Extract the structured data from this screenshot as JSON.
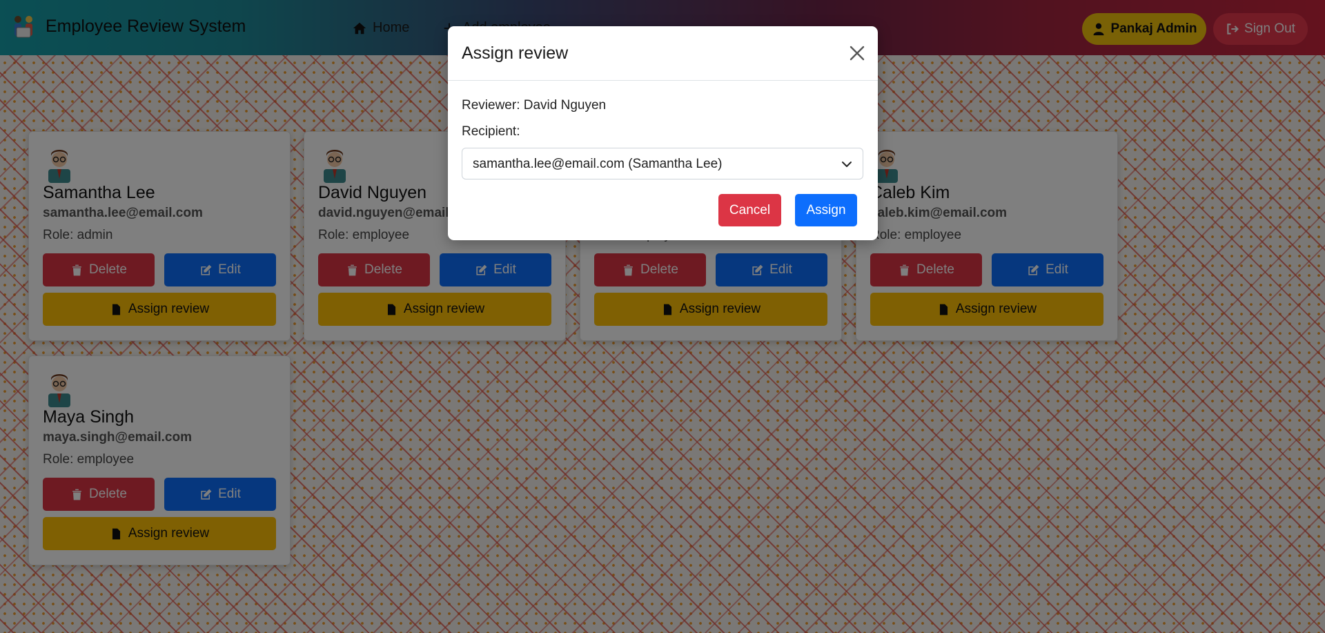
{
  "app": {
    "title": "Employee Review System"
  },
  "nav": {
    "home_label": "Home",
    "add_label": "Add employee"
  },
  "user": {
    "name": "Pankaj Admin",
    "signout_label": "Sign Out"
  },
  "card_actions": {
    "delete_label": "Delete",
    "edit_label": "Edit",
    "assign_label": "Assign review"
  },
  "employees": [
    {
      "name": "Samantha Lee",
      "email": "samantha.lee@email.com",
      "role": "Role: admin"
    },
    {
      "name": "David Nguyen",
      "email": "david.nguyen@email.com",
      "role": "Role: employee"
    },
    {
      "name": "",
      "email": "",
      "role": "Role: employee"
    },
    {
      "name": "Caleb Kim",
      "email": "caleb.kim@email.com",
      "role": "Role: employee"
    },
    {
      "name": "Maya Singh",
      "email": "maya.singh@email.com",
      "role": "Role: employee"
    }
  ],
  "modal": {
    "title": "Assign review",
    "reviewer_text": "Reviewer: David Nguyen",
    "recipient_label": "Recipient:",
    "recipient_value": "samantha.lee@email.com (Samantha Lee)",
    "cancel_label": "Cancel",
    "assign_label": "Assign"
  },
  "colors": {
    "delete": "#dc3545",
    "edit": "#0d6efd",
    "assign_review": "#ffc107",
    "admin_badge": "#f3c20c",
    "sign_out": "#e6384d"
  }
}
